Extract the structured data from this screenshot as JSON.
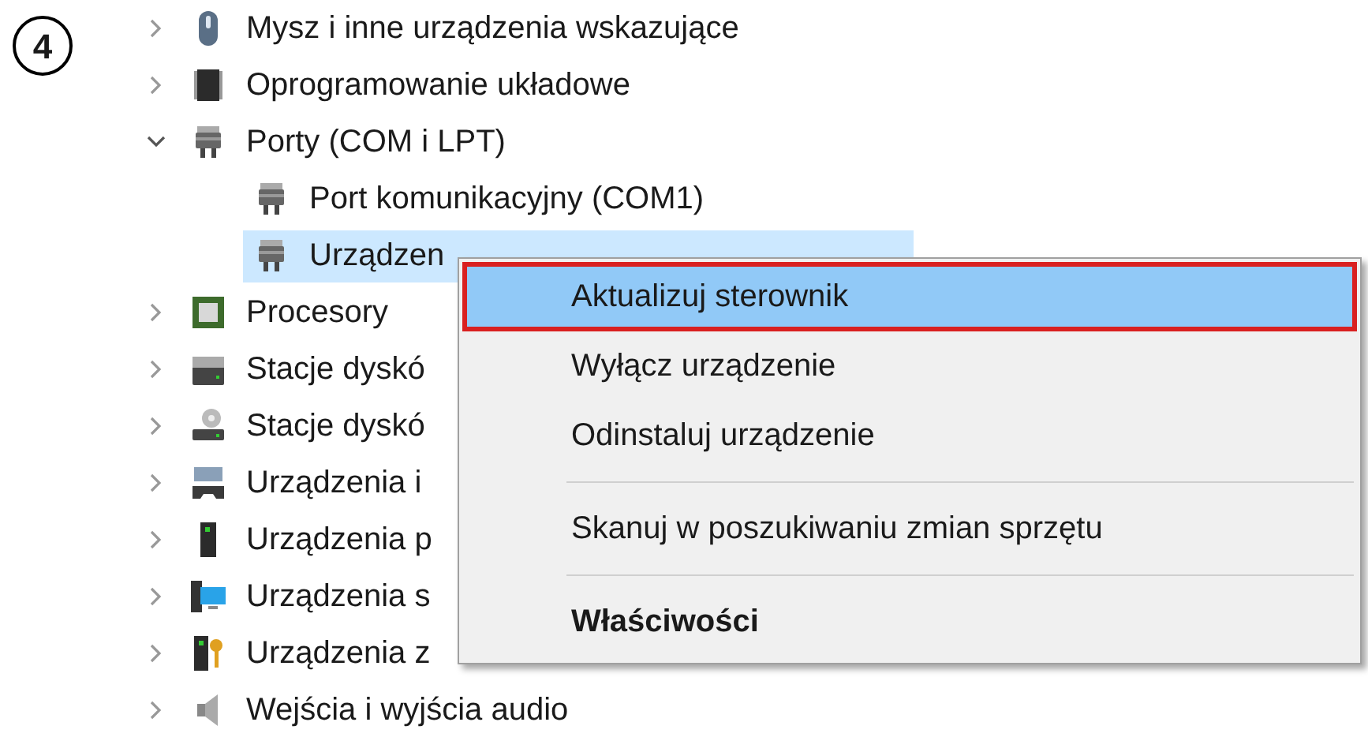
{
  "step_badge": "4",
  "tree": [
    {
      "label": "Mysz i inne urządzenia wskazujące",
      "kind": "mouse",
      "expanded": false
    },
    {
      "label": "Oprogramowanie układowe",
      "kind": "chip",
      "expanded": false
    },
    {
      "label": "Porty (COM i LPT)",
      "kind": "port",
      "expanded": true,
      "children": [
        {
          "label": "Port komunikacyjny (COM1)",
          "kind": "port",
          "selected": false
        },
        {
          "label": "Urządzen",
          "kind": "port",
          "selected": true
        }
      ]
    },
    {
      "label": "Procesory",
      "kind": "cpu",
      "expanded": false
    },
    {
      "label": "Stacje dyskó",
      "kind": "disk",
      "expanded": false
    },
    {
      "label": "Stacje dyskó",
      "kind": "optical",
      "expanded": false
    },
    {
      "label": "Urządzenia i",
      "kind": "hid",
      "expanded": false
    },
    {
      "label": "Urządzenia p",
      "kind": "tower",
      "expanded": false
    },
    {
      "label": "Urządzenia s",
      "kind": "computer",
      "expanded": false
    },
    {
      "label": "Urządzenia z",
      "kind": "security",
      "expanded": false
    },
    {
      "label": "Wejścia i wyjścia audio",
      "kind": "speaker",
      "expanded": false
    }
  ],
  "context_menu": {
    "items": [
      {
        "kind": "item",
        "label": "Aktualizuj sterownik",
        "selected": true,
        "bold": false
      },
      {
        "kind": "item",
        "label": "Wyłącz urządzenie",
        "selected": false,
        "bold": false
      },
      {
        "kind": "item",
        "label": "Odinstaluj urządzenie",
        "selected": false,
        "bold": false
      },
      {
        "kind": "separator"
      },
      {
        "kind": "item",
        "label": "Skanuj w poszukiwaniu zmian sprzętu",
        "selected": false,
        "bold": false
      },
      {
        "kind": "separator"
      },
      {
        "kind": "item",
        "label": "Właściwości",
        "selected": false,
        "bold": true
      }
    ]
  }
}
